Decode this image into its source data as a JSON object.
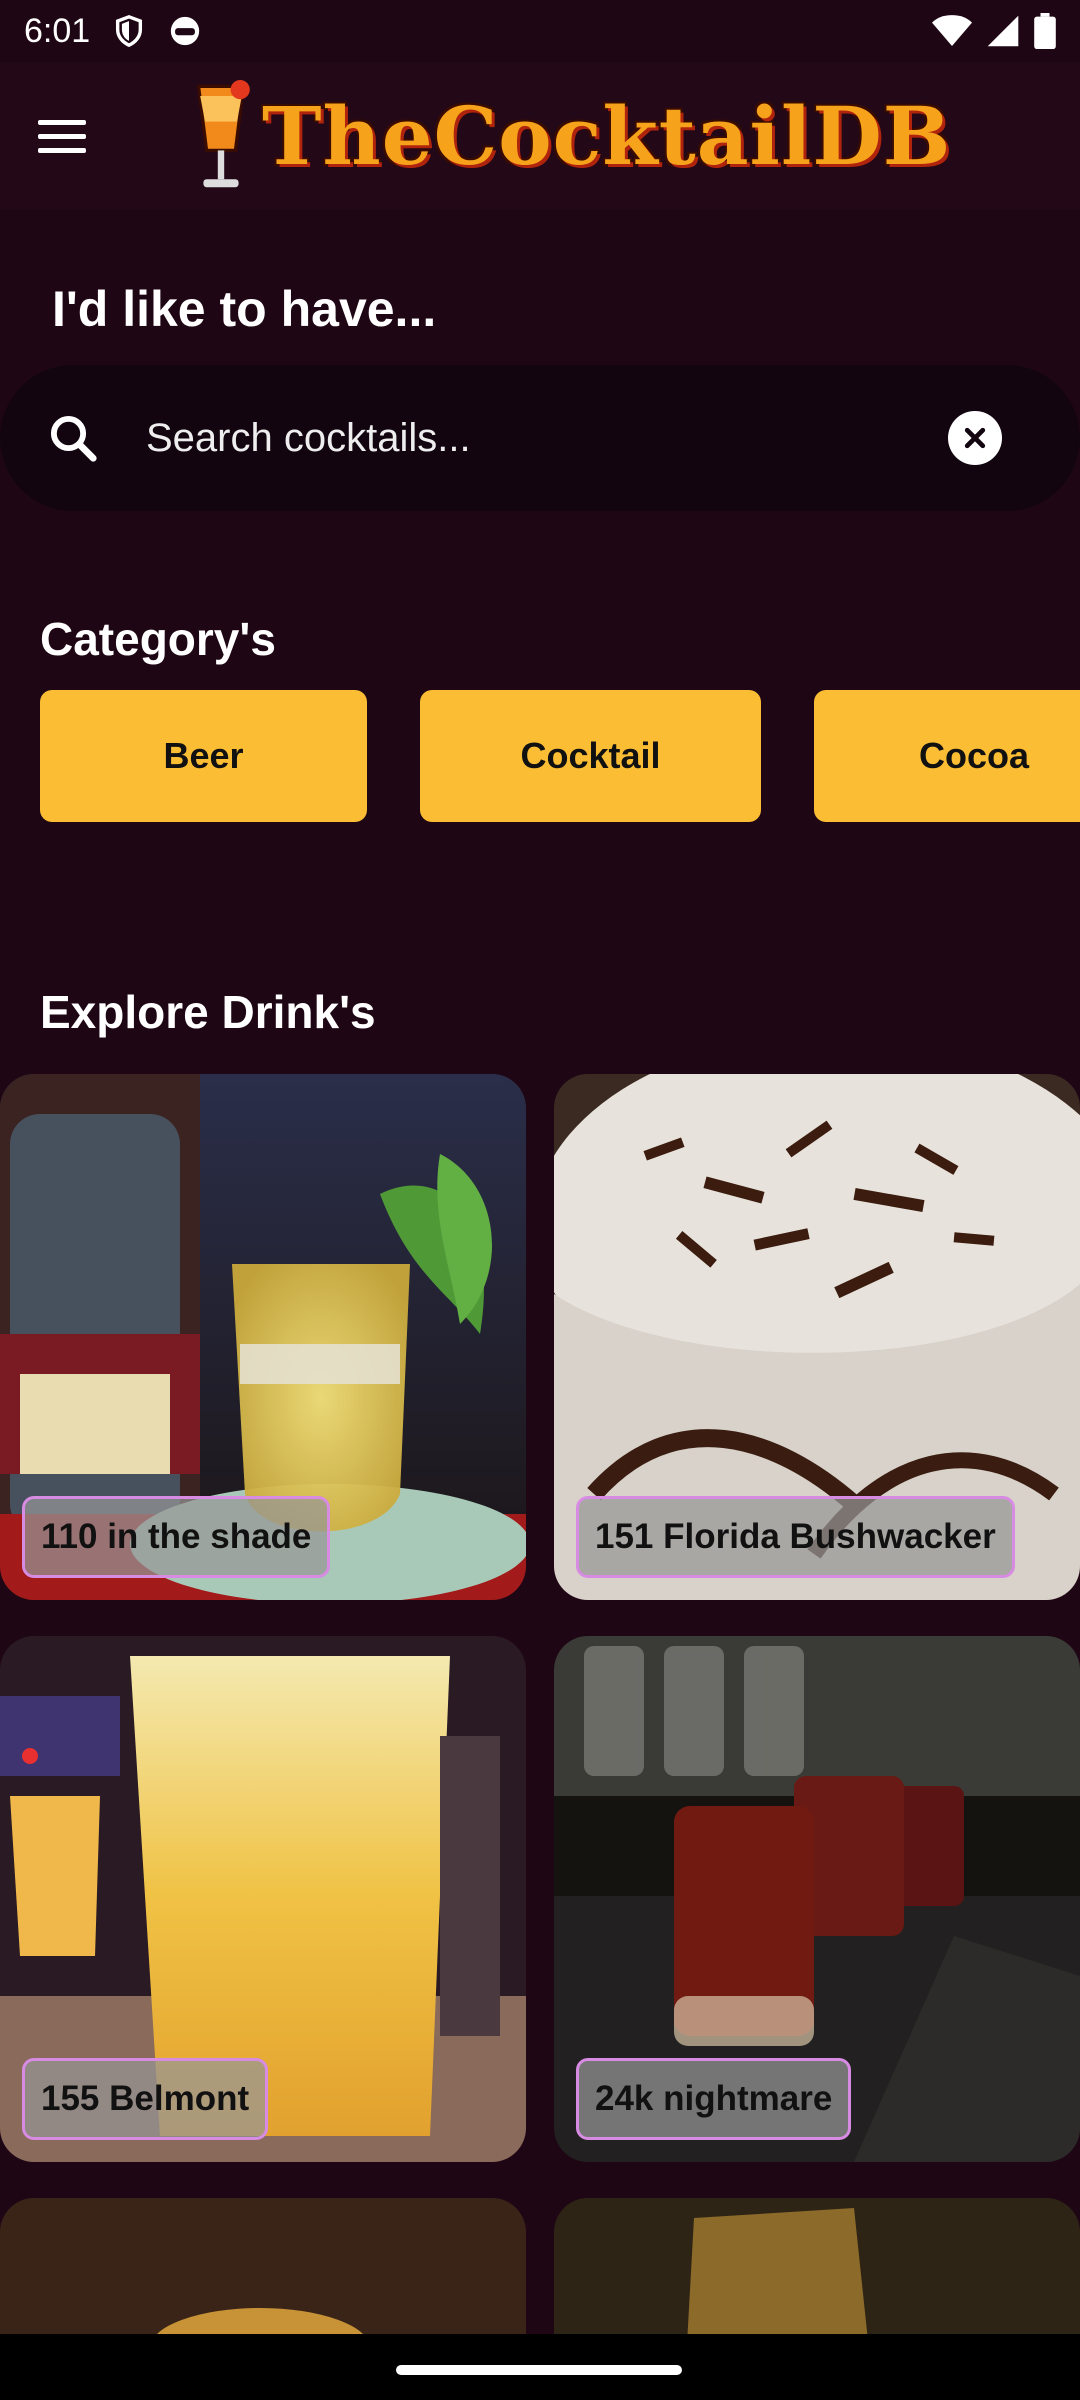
{
  "status_bar": {
    "time": "6:01"
  },
  "app": {
    "logo_text": "TheCocktailDB"
  },
  "heading": "I'd like to have...",
  "search": {
    "placeholder": "Search cocktails...",
    "value": ""
  },
  "categories": {
    "title": "Category's",
    "items": [
      {
        "label": "Beer"
      },
      {
        "label": "Cocktail"
      },
      {
        "label": "Cocoa"
      }
    ]
  },
  "explore": {
    "title": "Explore Drink's",
    "drinks": [
      {
        "name": "110 in the shade"
      },
      {
        "name": "151 Florida Bushwacker"
      },
      {
        "name": "155 Belmont"
      },
      {
        "name": "24k nightmare"
      }
    ]
  },
  "colors": {
    "background": "#1f0614",
    "app_bar": "#230818",
    "search_bar": "#120510",
    "chip": "#fbbd33",
    "label_border": "#d78be2"
  }
}
